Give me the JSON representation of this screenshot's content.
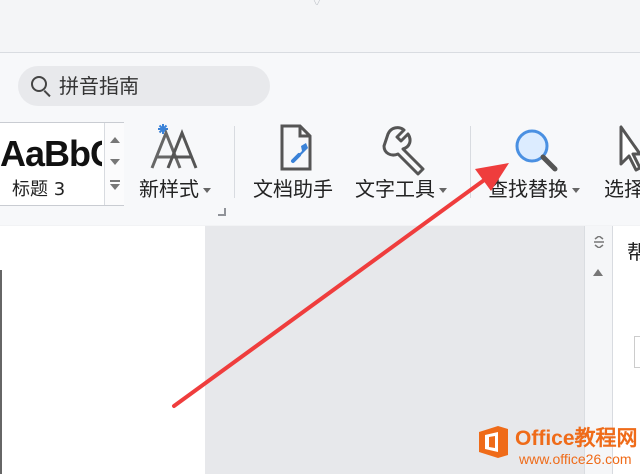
{
  "search": {
    "placeholder": "拼音指南",
    "icon": "search-icon"
  },
  "style_gallery": {
    "preview": "AaBbCc",
    "caption": "标题 3"
  },
  "ribbon": {
    "tools": [
      {
        "label": "新样式",
        "icon": "new-style-icon",
        "has_dropdown": true
      },
      {
        "label": "文档助手",
        "icon": "document-assistant-icon",
        "has_dropdown": false
      },
      {
        "label": "文字工具",
        "icon": "wrench-icon",
        "has_dropdown": true
      },
      {
        "label": "查找替换",
        "icon": "magnifier-icon",
        "has_dropdown": true
      },
      {
        "label": "选择",
        "icon": "cursor-icon",
        "has_dropdown": false
      }
    ]
  },
  "panel": {
    "title": "帮"
  },
  "watermark": {
    "brand": "Office教程网",
    "url": "www.office26.com"
  },
  "colors": {
    "accent_blue": "#4a90e2",
    "highlight_red": "#ef3d3d",
    "watermark_orange": "#ef6b19"
  }
}
